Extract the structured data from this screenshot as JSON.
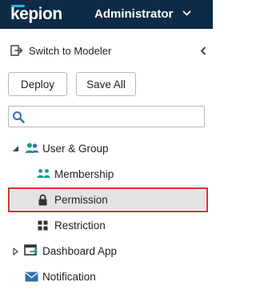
{
  "header": {
    "brand": "kepion",
    "role": "Administrator",
    "brand_accent_color": "#1eb6e8",
    "background_color": "#0d2b45"
  },
  "toolbar": {
    "switch_label": "Switch to Modeler",
    "deploy_label": "Deploy",
    "save_all_label": "Save All"
  },
  "search": {
    "value": "",
    "placeholder": ""
  },
  "tree": {
    "user_group": {
      "label": "User & Group",
      "expanded": true
    },
    "membership": {
      "label": "Membership"
    },
    "permission": {
      "label": "Permission",
      "selected": true
    },
    "restriction": {
      "label": "Restriction"
    },
    "dashboard_app": {
      "label": "Dashboard App",
      "expanded": false
    },
    "notification": {
      "label": "Notification"
    }
  },
  "colors": {
    "icon_teal": "#1a9c8c",
    "icon_blue": "#2d6fb0",
    "selection_border": "#d9302c",
    "selection_fill": "#e3e3e3"
  }
}
